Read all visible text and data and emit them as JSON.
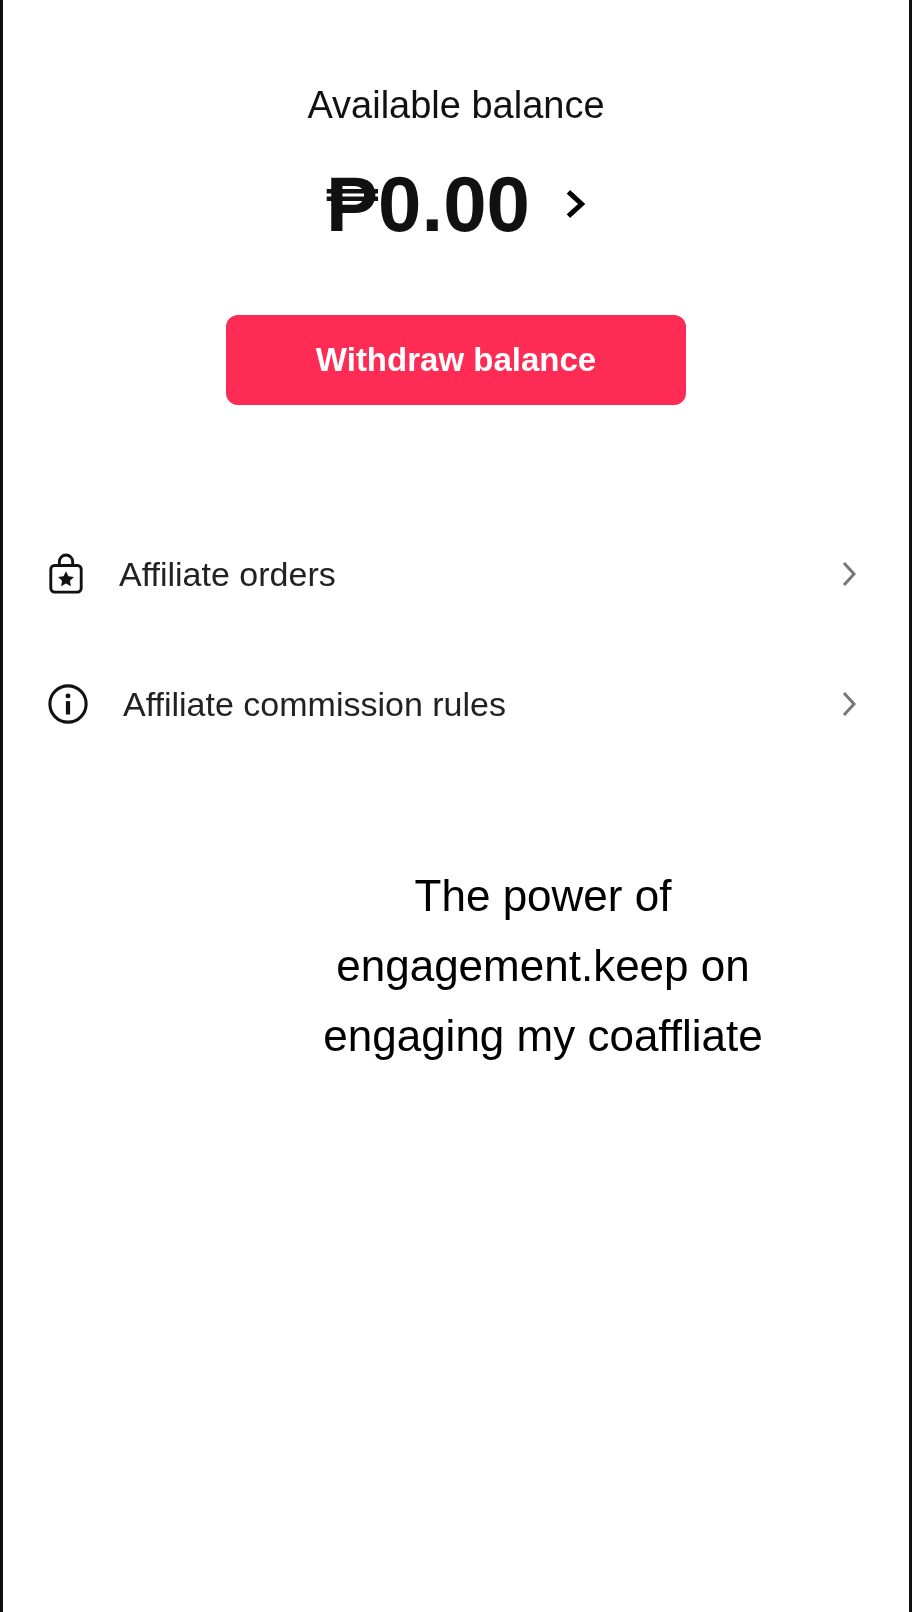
{
  "balance": {
    "label": "Available balance",
    "amount": "₱0.00"
  },
  "withdraw_button": {
    "label": "Withdraw balance"
  },
  "menu_items": [
    {
      "kind": "orders",
      "label": "Affiliate orders"
    },
    {
      "kind": "info",
      "label": "Affiliate commission rules"
    }
  ],
  "caption": "The power of\nengagement.keep on\nengaging my coaffliate"
}
